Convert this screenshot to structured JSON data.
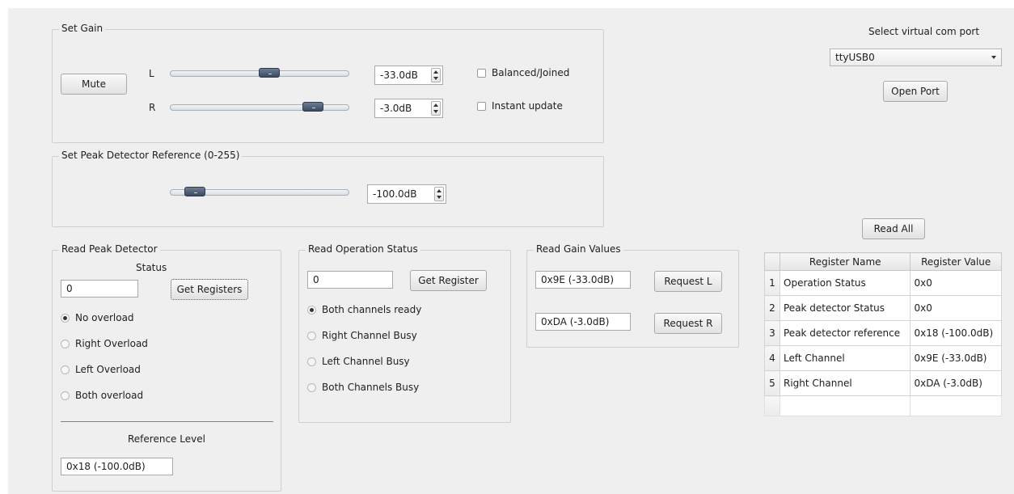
{
  "set_gain": {
    "title": "Set Gain",
    "mute_label": "Mute",
    "left_label": "L",
    "right_label": "R",
    "left_value": "-33.0dB",
    "right_value": "-3.0dB",
    "left_slider_fraction": 0.56,
    "right_slider_fraction": 0.84,
    "balanced_label": "Balanced/Joined",
    "instant_label": "Instant update",
    "balanced_checked": false,
    "instant_checked": false
  },
  "peak_ref": {
    "title": "Set Peak Detector Reference (0-255)",
    "value": "-100.0dB",
    "slider_fraction": 0.09
  },
  "com_port": {
    "title": "Select virtual com port",
    "selected": "ttyUSB0",
    "open_label": "Open Port"
  },
  "read_peak": {
    "title": "Read Peak Detector",
    "status_label": "Status",
    "status_value": "0",
    "get_registers_label": "Get Registers",
    "options": [
      "No overload",
      "Right Overload",
      "Left Overload",
      "Both overload"
    ],
    "selected_index": 0,
    "reference_label": "Reference Level",
    "reference_value": "0x18 (-100.0dB)"
  },
  "read_status": {
    "title": "Read Operation Status",
    "value": "0",
    "get_register_label": "Get Register",
    "options": [
      "Both channels ready",
      "Right Channel Busy",
      "Left Channel Busy",
      "Both Channels Busy"
    ],
    "selected_index": 0
  },
  "read_gain": {
    "title": "Read Gain Values",
    "left_value": "0x9E (-33.0dB)",
    "right_value": "0xDA (-3.0dB)",
    "request_l_label": "Request L",
    "request_r_label": "Request R"
  },
  "read_all_label": "Read All",
  "register_table": {
    "headers": [
      "Register Name",
      "Register Value"
    ],
    "rows": [
      {
        "num": "1",
        "name": "Operation Status",
        "value": "0x0"
      },
      {
        "num": "2",
        "name": "Peak detector Status",
        "value": "0x0"
      },
      {
        "num": "3",
        "name": "Peak detector reference",
        "value": "0x18 (-100.0dB)"
      },
      {
        "num": "4",
        "name": "Left Channel",
        "value": "0x9E (-33.0dB)"
      },
      {
        "num": "5",
        "name": "Right Channel",
        "value": "0xDA (-3.0dB)"
      }
    ]
  }
}
